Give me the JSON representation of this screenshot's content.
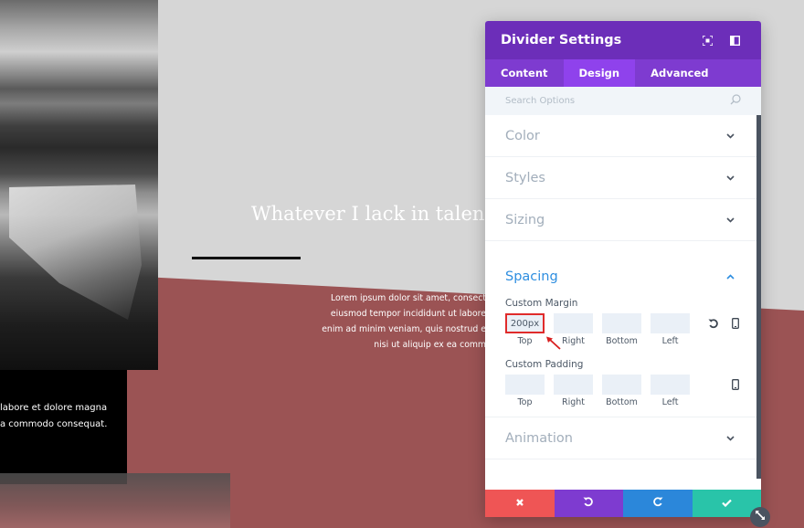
{
  "page": {
    "headline": "Whatever I lack in talen",
    "lorem_lines": [
      "Lorem ipsum dolor sit amet, consect",
      "eiusmod tempor incididunt ut labore",
      "enim ad minim veniam, quis nostrud e",
      "nisi ut aliquip ex ea comm"
    ],
    "black_box_lines": [
      "labore et dolore magna",
      "a commodo consequat."
    ]
  },
  "panel": {
    "title": "Divider Settings",
    "header_icons": [
      "fullscreen-icon",
      "sidebar-layout-icon"
    ],
    "tabs": [
      {
        "label": "Content",
        "active": false
      },
      {
        "label": "Design",
        "active": true
      },
      {
        "label": "Advanced",
        "active": false
      }
    ],
    "search": {
      "placeholder": "Search Options",
      "value": ""
    },
    "groups": [
      {
        "title": "Color",
        "open": false
      },
      {
        "title": "Styles",
        "open": false
      },
      {
        "title": "Sizing",
        "open": false
      },
      {
        "title": "Spacing",
        "open": true
      },
      {
        "title": "Animation",
        "open": false
      }
    ],
    "spacing": {
      "margin": {
        "label": "Custom Margin",
        "fields": [
          {
            "label": "Top",
            "value": "200px"
          },
          {
            "label": "Right",
            "value": ""
          },
          {
            "label": "Bottom",
            "value": ""
          },
          {
            "label": "Left",
            "value": ""
          }
        ]
      },
      "padding": {
        "label": "Custom Padding",
        "fields": [
          {
            "label": "Top",
            "value": ""
          },
          {
            "label": "Right",
            "value": ""
          },
          {
            "label": "Bottom",
            "value": ""
          },
          {
            "label": "Left",
            "value": ""
          }
        ]
      }
    },
    "footer_buttons": [
      {
        "action": "cancel",
        "color": "#ef5555"
      },
      {
        "action": "undo",
        "color": "#7e3bd0"
      },
      {
        "action": "redo",
        "color": "#2b87da"
      },
      {
        "action": "save",
        "color": "#29c4a9"
      }
    ]
  },
  "colors": {
    "header_purple": "#6c2eb9",
    "tab_purple": "#7e3bd0",
    "active_tab": "#8f42ec",
    "accent_blue": "#2e8ee0",
    "section_red": "#9b5354",
    "highlight_red": "#e02b2b"
  }
}
